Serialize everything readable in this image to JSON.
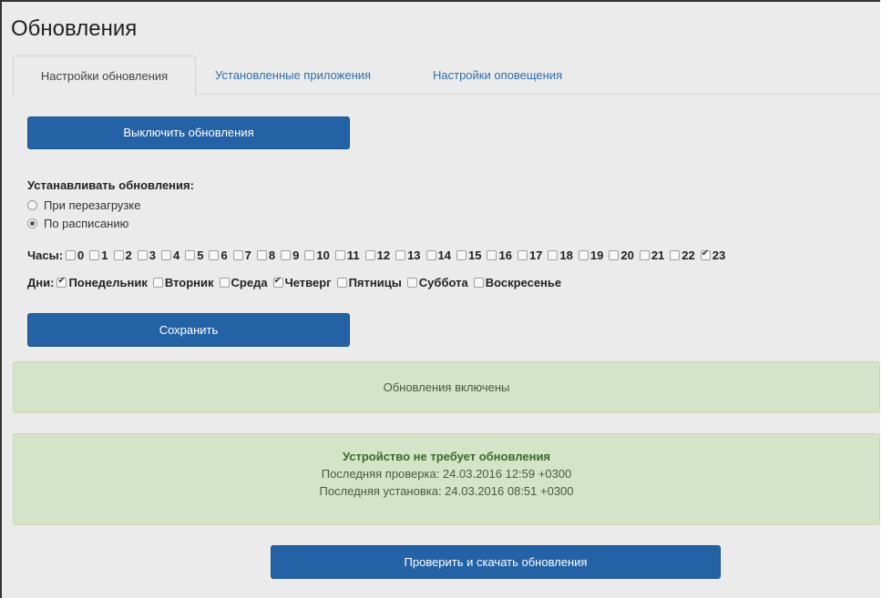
{
  "page": {
    "title": "Обновления"
  },
  "tabs": [
    {
      "label": "Настройки обновления"
    },
    {
      "label": "Установленные приложения"
    },
    {
      "label": "Настройки оповещения"
    }
  ],
  "actions": {
    "disable_updates": "Выключить обновления",
    "save": "Сохранить",
    "check_download": "Проверить и скачать обновления"
  },
  "install": {
    "label": "Устанавливать обновления:",
    "options": [
      {
        "label": "При перезагрузке",
        "checked": false
      },
      {
        "label": "По расписанию",
        "checked": true
      }
    ]
  },
  "hours": {
    "label": "Часы:",
    "items": [
      {
        "label": "0",
        "checked": false
      },
      {
        "label": "1",
        "checked": false
      },
      {
        "label": "2",
        "checked": false
      },
      {
        "label": "3",
        "checked": false
      },
      {
        "label": "4",
        "checked": false
      },
      {
        "label": "5",
        "checked": false
      },
      {
        "label": "6",
        "checked": false
      },
      {
        "label": "7",
        "checked": false
      },
      {
        "label": "8",
        "checked": false
      },
      {
        "label": "9",
        "checked": false
      },
      {
        "label": "10",
        "checked": false
      },
      {
        "label": "11",
        "checked": false
      },
      {
        "label": "12",
        "checked": false
      },
      {
        "label": "13",
        "checked": false
      },
      {
        "label": "14",
        "checked": false
      },
      {
        "label": "15",
        "checked": false
      },
      {
        "label": "16",
        "checked": false
      },
      {
        "label": "17",
        "checked": false
      },
      {
        "label": "18",
        "checked": false
      },
      {
        "label": "19",
        "checked": false
      },
      {
        "label": "20",
        "checked": false
      },
      {
        "label": "21",
        "checked": false
      },
      {
        "label": "22",
        "checked": false
      },
      {
        "label": "23",
        "checked": true
      }
    ]
  },
  "days": {
    "label": "Дни:",
    "items": [
      {
        "label": "Понедельник",
        "checked": true
      },
      {
        "label": "Вторник",
        "checked": false
      },
      {
        "label": "Среда",
        "checked": false
      },
      {
        "label": "Четверг",
        "checked": true
      },
      {
        "label": "Пятницы",
        "checked": false
      },
      {
        "label": "Суббота",
        "checked": false
      },
      {
        "label": "Воскресенье",
        "checked": false
      }
    ]
  },
  "alerts": {
    "enabled": "Обновления включены",
    "status_title": "Устройство не требует обновления",
    "last_check": "Последняя проверка: 24.03.2016 12:59 +0300",
    "last_install": "Последняя установка: 24.03.2016 08:51 +0300"
  },
  "colors": {
    "button": "#2462a6",
    "tab_link": "#2f6fad",
    "alert_bg": "#d3e4c8",
    "page_bg": "#ebebeb"
  }
}
